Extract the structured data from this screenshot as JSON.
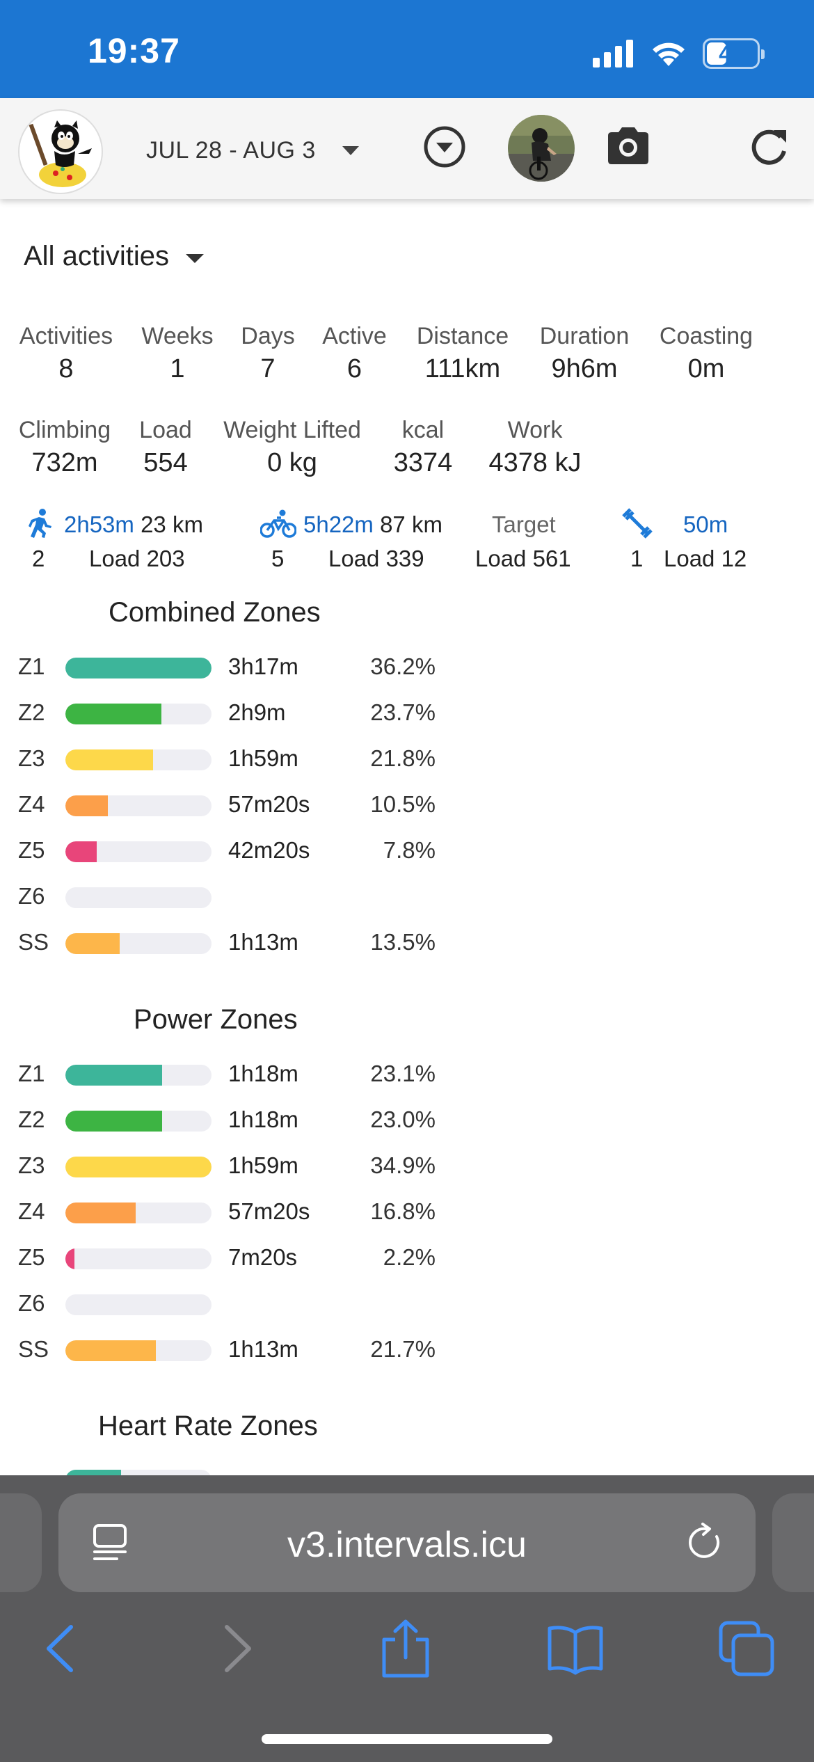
{
  "status": {
    "time": "19:37",
    "battery": "40"
  },
  "toolbar": {
    "date_range": "JUL 28 - AUG 3"
  },
  "filter": {
    "label": "All activities"
  },
  "stats_row1": [
    {
      "label": "Activities",
      "value": "8"
    },
    {
      "label": "Weeks",
      "value": "1"
    },
    {
      "label": "Days",
      "value": "7"
    },
    {
      "label": "Active",
      "value": "6"
    },
    {
      "label": "Distance",
      "value": "111km"
    },
    {
      "label": "Duration",
      "value": "9h6m"
    },
    {
      "label": "Coasting",
      "value": "0m"
    }
  ],
  "stats_row2": [
    {
      "label": "Climbing",
      "value": "732m"
    },
    {
      "label": "Load",
      "value": "554"
    },
    {
      "label": "Weight Lifted",
      "value": "0 kg"
    },
    {
      "label": "kcal",
      "value": "3374"
    },
    {
      "label": "Work",
      "value": "4378 kJ"
    }
  ],
  "sports": {
    "run": {
      "time": "2h53m",
      "distance": "23 km",
      "count": "2",
      "load": "Load 203"
    },
    "ride": {
      "time": "5h22m",
      "distance": "87 km",
      "count": "5",
      "load": "Load 339"
    },
    "target": {
      "label": "Target",
      "load": "Load 561"
    },
    "weights": {
      "time": "50m",
      "count": "1",
      "load": "Load 12"
    }
  },
  "combined_zones": {
    "title": "Combined Zones",
    "rows": [
      {
        "zone": "Z1",
        "time": "3h17m",
        "pct": "36.2%",
        "fill": 1.0,
        "color": "#3db59a"
      },
      {
        "zone": "Z2",
        "time": "2h9m",
        "pct": "23.7%",
        "fill": 0.655,
        "color": "#3db443"
      },
      {
        "zone": "Z3",
        "time": "1h59m",
        "pct": "21.8%",
        "fill": 0.6,
        "color": "#fdd84a"
      },
      {
        "zone": "Z4",
        "time": "57m20s",
        "pct": "10.5%",
        "fill": 0.29,
        "color": "#fc9f4a"
      },
      {
        "zone": "Z5",
        "time": "42m20s",
        "pct": "7.8%",
        "fill": 0.215,
        "color": "#e8457a"
      },
      {
        "zone": "Z6",
        "time": "",
        "pct": "",
        "fill": 0,
        "color": "#9c5ad1"
      },
      {
        "zone": "SS",
        "time": "1h13m",
        "pct": "13.5%",
        "fill": 0.37,
        "color": "#fdb64a"
      }
    ]
  },
  "power_zones": {
    "title": "Power Zones",
    "rows": [
      {
        "zone": "Z1",
        "time": "1h18m",
        "pct": "23.1%",
        "fill": 0.66,
        "color": "#3db59a"
      },
      {
        "zone": "Z2",
        "time": "1h18m",
        "pct": "23.0%",
        "fill": 0.66,
        "color": "#3db443"
      },
      {
        "zone": "Z3",
        "time": "1h59m",
        "pct": "34.9%",
        "fill": 1.0,
        "color": "#fdd84a"
      },
      {
        "zone": "Z4",
        "time": "57m20s",
        "pct": "16.8%",
        "fill": 0.48,
        "color": "#fc9f4a"
      },
      {
        "zone": "Z5",
        "time": "7m20s",
        "pct": "2.2%",
        "fill": 0.06,
        "color": "#e8457a"
      },
      {
        "zone": "Z6",
        "time": "",
        "pct": "",
        "fill": 0,
        "color": "#9c5ad1"
      },
      {
        "zone": "SS",
        "time": "1h13m",
        "pct": "21.7%",
        "fill": 0.62,
        "color": "#fdb64a"
      }
    ]
  },
  "heart_rate_zones": {
    "title": "Heart Rate Zones"
  },
  "browser": {
    "url": "v3.intervals.icu"
  }
}
